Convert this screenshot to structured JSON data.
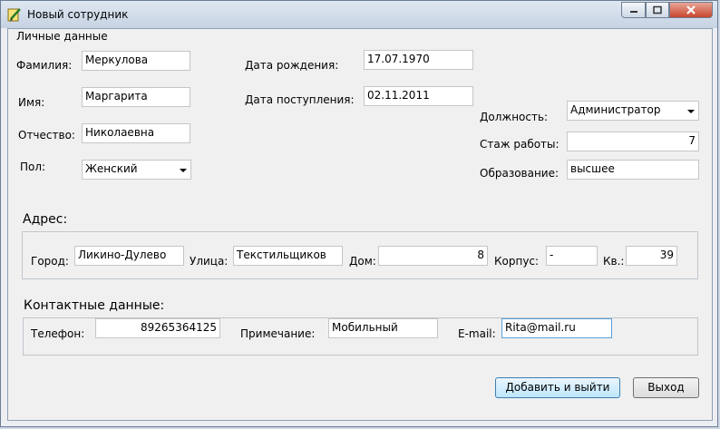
{
  "window": {
    "title": "Новый сотрудник"
  },
  "personal": {
    "group_title": "Личные данные",
    "surname_label": "Фамилия:",
    "surname": "Меркулова",
    "name_label": "Имя:",
    "name": "Маргарита",
    "patronymic_label": "Отчество:",
    "patronymic": "Николаевна",
    "gender_label": "Пол:",
    "gender": "Женский",
    "birth_label": "Дата рождения:",
    "birth_date": "17.07.1970",
    "hire_label": "Дата поступления:",
    "hire_date": "02.11.2011",
    "position_label": "Должность:",
    "position": "Администратор",
    "experience_label": "Стаж работы:",
    "experience": "7",
    "education_label": "Образование:",
    "education": "высшее"
  },
  "address": {
    "title": "Адрес:",
    "city_label": "Город:",
    "city": "Ликино-Дулево",
    "street_label": "Улица:",
    "street": "Текстильщиков",
    "house_label": "Дом:",
    "house": "8",
    "building_label": "Корпус:",
    "building": "-",
    "apt_label": "Кв.:",
    "apt": "39"
  },
  "contacts": {
    "title": "Контактные данные:",
    "phone_label": "Телефон:",
    "phone": "89265364125",
    "note_label": "Примечание:",
    "note": "Мобильный",
    "email_label": "E-mail:",
    "email": "Rita@mail.ru"
  },
  "buttons": {
    "add_exit": "Добавить и выйти",
    "exit": "Выход"
  },
  "icons": {
    "app": "pencil-app-icon",
    "minimize": "minimize-icon",
    "maximize": "maximize-icon",
    "close": "close-icon"
  }
}
